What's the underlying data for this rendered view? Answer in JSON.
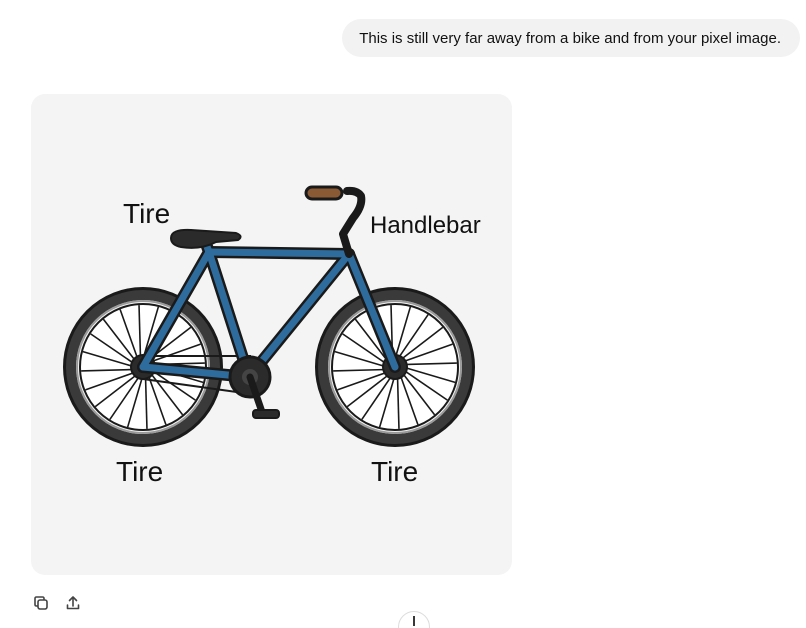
{
  "conversation": {
    "user_message": "This is still very far away from a bike and from your pixel image."
  },
  "generated_image": {
    "labels": {
      "top_left": "Tire",
      "handlebar": "Handlebar",
      "bottom_left": "Tire",
      "bottom_right": "Tire"
    },
    "colors": {
      "frame": "#2f6c9e",
      "outline": "#1a1a1a",
      "tire": "#2b2b2b",
      "grip": "#8a5a35",
      "background": "#f4f4f4"
    }
  },
  "actions": {
    "copy_icon": "copy-icon",
    "share_icon": "share-icon",
    "scroll_icon": "arrow-down-icon"
  }
}
